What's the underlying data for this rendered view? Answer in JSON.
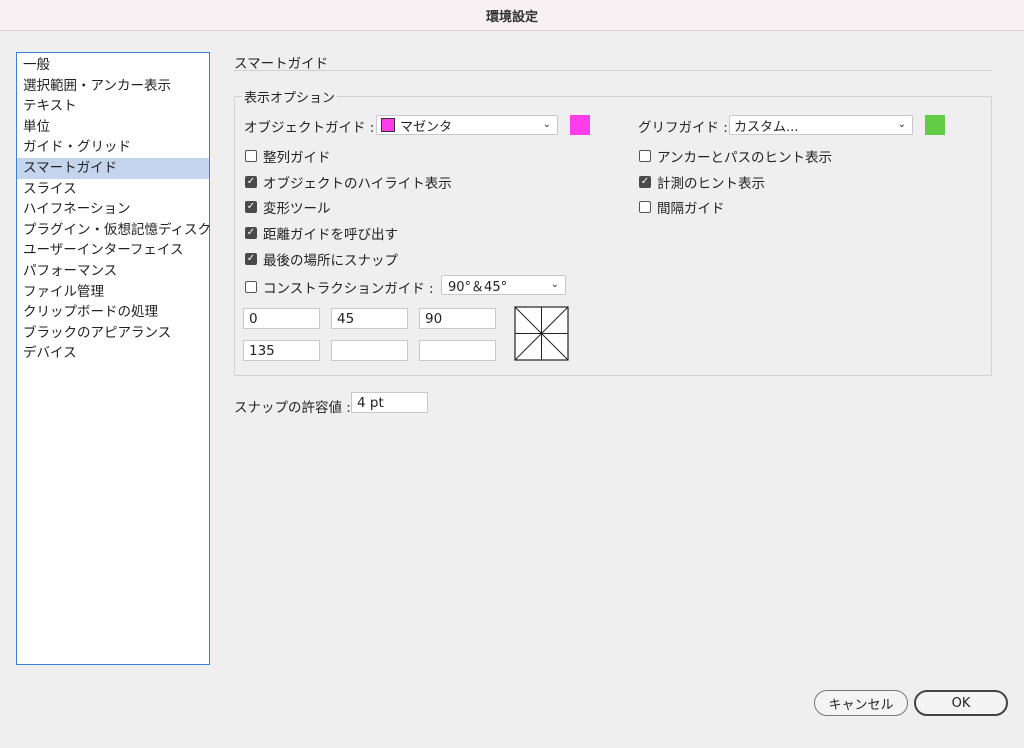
{
  "window": {
    "title": "環境設定"
  },
  "sidebar": {
    "items": [
      {
        "label": "一般"
      },
      {
        "label": "選択範囲・アンカー表示"
      },
      {
        "label": "テキスト"
      },
      {
        "label": "単位"
      },
      {
        "label": "ガイド・グリッド"
      },
      {
        "label": "スマートガイド",
        "selected": true
      },
      {
        "label": "スライス"
      },
      {
        "label": "ハイフネーション"
      },
      {
        "label": "プラグイン・仮想記憶ディスク"
      },
      {
        "label": "ユーザーインターフェイス"
      },
      {
        "label": "パフォーマンス"
      },
      {
        "label": "ファイル管理"
      },
      {
        "label": "クリップボードの処理"
      },
      {
        "label": "ブラックのアピアランス"
      },
      {
        "label": "デバイス"
      }
    ]
  },
  "main": {
    "section_title": "スマートガイド",
    "display_options": {
      "group_label": "表示オプション",
      "object_guide": {
        "label": "オブジェクトガイド :",
        "value": "マゼンタ",
        "color": "#ff3dea"
      },
      "glyph_guide": {
        "label": "グリフガイド :",
        "value": "カスタム...",
        "color": "#62cc47"
      },
      "checkboxes_left": [
        {
          "label": "整列ガイド",
          "checked": false
        },
        {
          "label": "オブジェクトのハイライト表示",
          "checked": true
        },
        {
          "label": "変形ツール",
          "checked": true
        },
        {
          "label": "距離ガイドを呼び出す",
          "checked": true
        },
        {
          "label": "最後の場所にスナップ",
          "checked": true
        }
      ],
      "checkboxes_right": [
        {
          "label": "アンカーとパスのヒント表示",
          "checked": false
        },
        {
          "label": "計測のヒント表示",
          "checked": true
        },
        {
          "label": "間隔ガイド",
          "checked": false
        }
      ],
      "construction_guide": {
        "label": "コンストラクションガイド :",
        "checked": false,
        "value": "90°＆45°",
        "angles": [
          "0",
          "45",
          "90",
          "135",
          "",
          ""
        ]
      }
    },
    "snap_tolerance": {
      "label": "スナップの許容値 :",
      "value": "4 pt"
    }
  },
  "buttons": {
    "cancel": "キャンセル",
    "ok": "OK"
  },
  "icons": {
    "checkmark": "✓",
    "chevron": "⌄"
  }
}
